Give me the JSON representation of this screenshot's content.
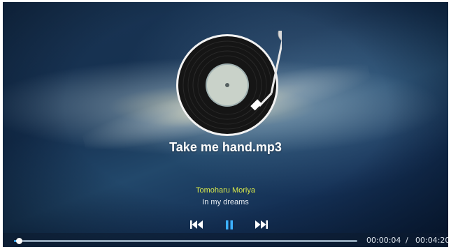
{
  "track": {
    "title": "Take me hand.mp3",
    "artist": "Tomoharu Moriya",
    "album": "In my dreams"
  },
  "controls": {
    "prev_icon": "skip-previous-icon",
    "pause_icon": "pause-icon",
    "next_icon": "skip-next-icon"
  },
  "progress": {
    "elapsed": "00:00:04",
    "separator": "/",
    "total": "00:04:20",
    "fraction": 0.015
  },
  "colors": {
    "accent": "#3db1ff",
    "artist": "#d8e84a"
  }
}
